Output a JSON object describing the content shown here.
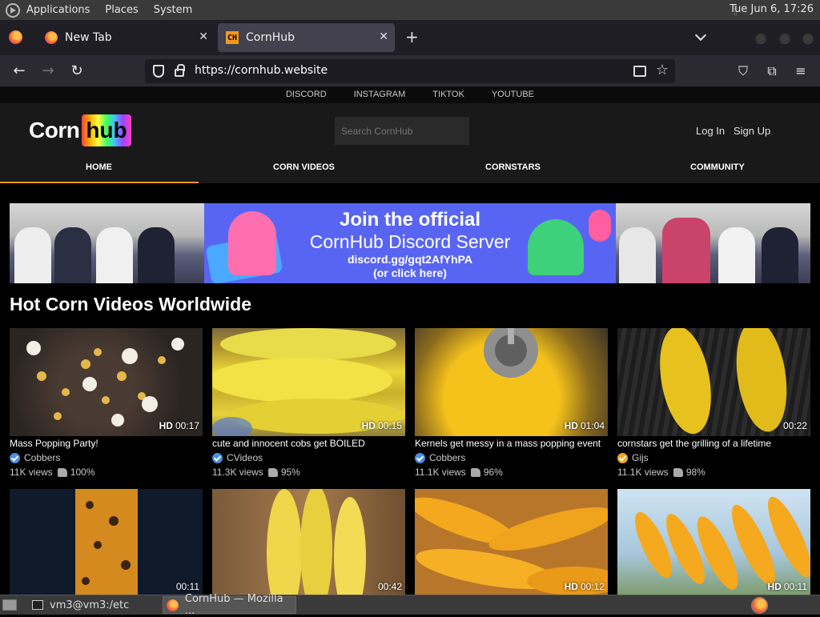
{
  "system_panel": {
    "menus": [
      "Applications",
      "Places",
      "System"
    ],
    "clock": "Tue Jun  6, 17:26"
  },
  "browser": {
    "tabs": [
      {
        "title": "New Tab",
        "icon": "firefox-icon"
      },
      {
        "title": "CornHub",
        "icon": "ch-favicon",
        "active": true
      }
    ],
    "url": "https://cornhub.website"
  },
  "site": {
    "social_links": [
      "DISCORD",
      "INSTAGRAM",
      "TIKTOK",
      "YOUTUBE"
    ],
    "logo": {
      "left": "Corn",
      "right": "hub"
    },
    "search_placeholder": "Search CornHub",
    "auth": {
      "login": "Log In",
      "signup": "Sign Up"
    },
    "nav": [
      "HOME",
      "CORN VIDEOS",
      "CORNSTARS",
      "COMMUNITY"
    ],
    "accent_color": "#f7971d",
    "banner": {
      "line1": "Join the official",
      "line2": "CornHub Discord Server",
      "line3": "discord.gg/gqt2AfYhPA",
      "line4": "(or click here)"
    },
    "section_title": "Hot Corn Videos Worldwide",
    "videos": [
      {
        "title": "Mass Popping Party!",
        "channel": "Cobbers",
        "badge": "verified",
        "views": "11K views",
        "rating": "100%",
        "hd": "HD",
        "duration": "00:17"
      },
      {
        "title": "cute and innocent cobs get BOILED",
        "channel": "CVideos",
        "badge": "verified",
        "views": "11.3K views",
        "rating": "95%",
        "hd": "HD",
        "duration": "00:15"
      },
      {
        "title": "Kernels get messy in a mass popping event",
        "channel": "Cobbers",
        "badge": "verified",
        "views": "11.1K views",
        "rating": "96%",
        "hd": "HD",
        "duration": "01:04"
      },
      {
        "title": "cornstars get the grilling of a lifetime",
        "channel": "Gijs",
        "badge": "gold",
        "views": "11.1K views",
        "rating": "98%",
        "hd": "",
        "duration": "00:22"
      },
      {
        "title": "",
        "channel": "",
        "badge": "",
        "views": "",
        "rating": "",
        "hd": "",
        "duration": "00:11"
      },
      {
        "title": "",
        "channel": "",
        "badge": "",
        "views": "",
        "rating": "",
        "hd": "",
        "duration": "00:42"
      },
      {
        "title": "",
        "channel": "",
        "badge": "",
        "views": "",
        "rating": "",
        "hd": "HD",
        "duration": "00:12"
      },
      {
        "title": "",
        "channel": "",
        "badge": "",
        "views": "",
        "rating": "",
        "hd": "HD",
        "duration": "00:11"
      }
    ]
  },
  "taskbar": {
    "tasks": [
      {
        "label": "vm3@vm3:/etc",
        "icon": "terminal-icon"
      },
      {
        "label": "CornHub — Mozilla ...",
        "icon": "firefox-icon",
        "active": true
      }
    ]
  }
}
